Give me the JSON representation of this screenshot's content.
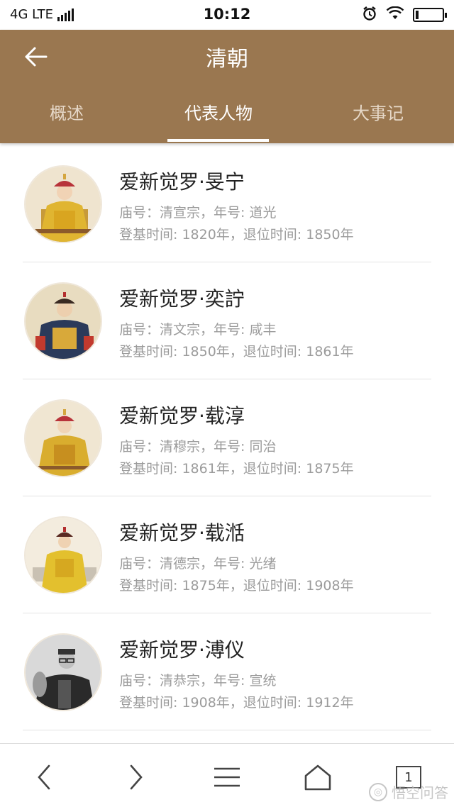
{
  "status_bar": {
    "network": "4G LTE",
    "time": "10:12"
  },
  "header": {
    "title": "清朝",
    "back_icon": "arrow-left-icon"
  },
  "tabs": [
    {
      "label": "概述",
      "active": false
    },
    {
      "label": "代表人物",
      "active": true
    },
    {
      "label": "大事记",
      "active": false
    }
  ],
  "people": [
    {
      "name": "爱新觉罗·旻宁",
      "temple_line": "庙号：清宣宗，年号: 道光",
      "reign_line": "登基时间: 1820年，退位时间: 1850年",
      "portrait": "emperor-daoguang-portrait"
    },
    {
      "name": "爱新觉罗·奕詝",
      "temple_line": "庙号：清文宗，年号: 咸丰",
      "reign_line": "登基时间: 1850年，退位时间: 1861年",
      "portrait": "emperor-xianfeng-portrait"
    },
    {
      "name": "爱新觉罗·载淳",
      "temple_line": "庙号：清穆宗，年号: 同治",
      "reign_line": "登基时间: 1861年，退位时间: 1875年",
      "portrait": "emperor-tongzhi-portrait"
    },
    {
      "name": "爱新觉罗·载湉",
      "temple_line": "庙号：清德宗，年号: 光绪",
      "reign_line": "登基时间: 1875年，退位时间: 1908年",
      "portrait": "emperor-guangxu-portrait"
    },
    {
      "name": "爱新觉罗·溥仪",
      "temple_line": "庙号：清恭宗，年号: 宣统",
      "reign_line": "登基时间: 1908年，退位时间: 1912年",
      "portrait": "emperor-xuantong-photo"
    }
  ],
  "bottom_nav": {
    "back_icon": "chevron-left-icon",
    "forward_icon": "chevron-right-icon",
    "menu_icon": "menu-icon",
    "home_icon": "home-icon",
    "tab_count": "1"
  },
  "watermark": {
    "text": "悟空问答"
  },
  "colors": {
    "header_bg": "#9a7750",
    "tab_inactive": "#e6d8c8",
    "text_primary": "#222222",
    "text_secondary": "#9b9b9b"
  }
}
